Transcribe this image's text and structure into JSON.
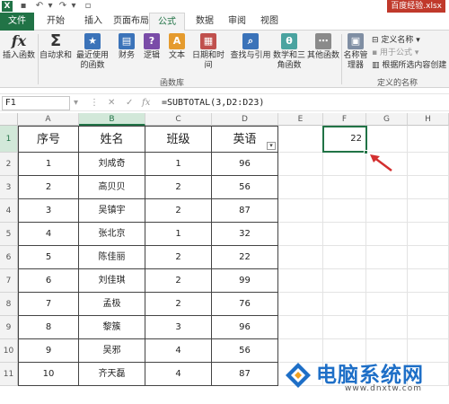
{
  "window": {
    "title": "百度经验.xlsx"
  },
  "tabs": [
    {
      "label": "文件"
    },
    {
      "label": "开始"
    },
    {
      "label": "插入"
    },
    {
      "label": "页面布局"
    },
    {
      "label": "公式",
      "active": true
    },
    {
      "label": "数据"
    },
    {
      "label": "审阅"
    },
    {
      "label": "视图"
    }
  ],
  "ribbon": {
    "buttons": [
      {
        "label": "插入函数",
        "icon": "fx-icon"
      },
      {
        "label": "自动求和",
        "icon": "sigma-icon"
      },
      {
        "label": "最近使用的函数",
        "icon": "star-icon"
      },
      {
        "label": "财务",
        "icon": "book-icon"
      },
      {
        "label": "逻辑",
        "icon": "question-icon"
      },
      {
        "label": "文本",
        "icon": "text-icon"
      },
      {
        "label": "日期和时间",
        "icon": "calendar-icon"
      },
      {
        "label": "查找与引用",
        "icon": "search-icon"
      },
      {
        "label": "数学和三角函数",
        "icon": "theta-icon"
      },
      {
        "label": "其他函数",
        "icon": "more-functions-icon"
      },
      {
        "label": "名称管理器",
        "icon": "name-manager-icon"
      }
    ],
    "group_label_functions": "函数库",
    "group_label_names": "定义的名称",
    "define_name": "定义名称",
    "use_in_formula": "用于公式",
    "create_from_selection": "根据所选内容创建"
  },
  "formula_bar": {
    "name_box": "F1",
    "formula": "=SUBTOTAL(3,D2:D23)"
  },
  "columns": [
    "A",
    "B",
    "C",
    "D",
    "E",
    "F",
    "G",
    "H"
  ],
  "rows": [
    "1",
    "2",
    "3",
    "4",
    "5",
    "6",
    "7",
    "8",
    "9",
    "10",
    "11"
  ],
  "table": {
    "headers": [
      "序号",
      "姓名",
      "班级",
      "英语"
    ],
    "rows": [
      [
        "1",
        "刘成奇",
        "1",
        "96"
      ],
      [
        "2",
        "高贝贝",
        "2",
        "56"
      ],
      [
        "3",
        "吴镇宇",
        "2",
        "87"
      ],
      [
        "4",
        "张北京",
        "1",
        "32"
      ],
      [
        "5",
        "陈佳丽",
        "2",
        "22"
      ],
      [
        "6",
        "刘佳琪",
        "2",
        "99"
      ],
      [
        "7",
        "孟极",
        "2",
        "76"
      ],
      [
        "8",
        "黎簇",
        "3",
        "96"
      ],
      [
        "9",
        "吴邪",
        "4",
        "56"
      ],
      [
        "10",
        "齐天磊",
        "4",
        "87"
      ]
    ]
  },
  "result_cell": {
    "value": "22"
  },
  "watermark": {
    "text": "电脑系统网",
    "url": "www.dnxtw.com"
  },
  "colors": {
    "excel_green": "#217346",
    "arrow_red": "#d32f2f",
    "watermark_blue": "#1e6fc7"
  }
}
